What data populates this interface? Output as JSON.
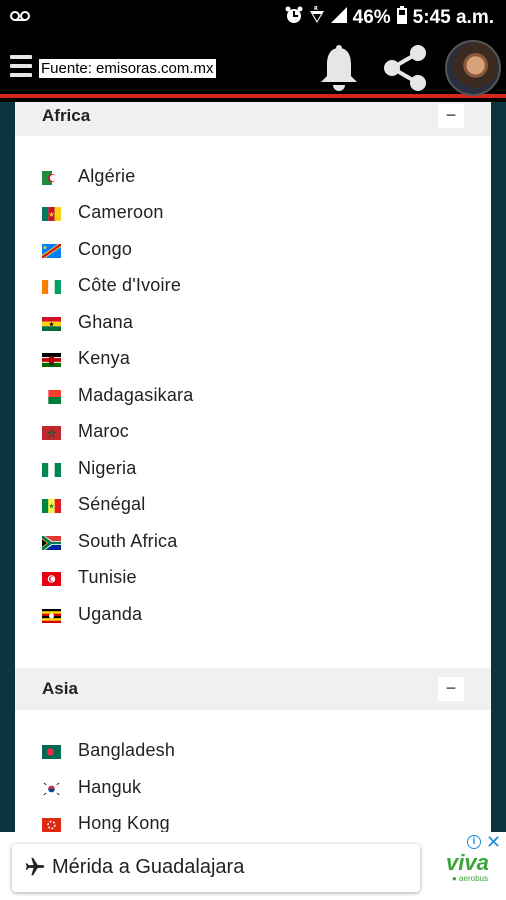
{
  "status_bar": {
    "battery": "46%",
    "time": "5:45 a.m.",
    "icons": [
      "voicemail-icon",
      "alarm-icon",
      "wifi-icon",
      "signal-icon",
      "battery-icon"
    ]
  },
  "app_bar": {
    "source_label": "Fuente: emisoras.com.mx",
    "icons": [
      "menu-icon",
      "bell-icon",
      "share-icon",
      "avatar"
    ]
  },
  "sections": [
    {
      "title": "Africa",
      "toggle": "−",
      "countries": [
        {
          "name": "Algérie",
          "flag": "algeria"
        },
        {
          "name": "Cameroon",
          "flag": "cameroon"
        },
        {
          "name": "Congo",
          "flag": "congo"
        },
        {
          "name": "Côte d'Ivoire",
          "flag": "cote-divoire"
        },
        {
          "name": "Ghana",
          "flag": "ghana"
        },
        {
          "name": "Kenya",
          "flag": "kenya"
        },
        {
          "name": "Madagasikara",
          "flag": "madagascar"
        },
        {
          "name": "Maroc",
          "flag": "morocco"
        },
        {
          "name": "Nigeria",
          "flag": "nigeria"
        },
        {
          "name": "Sénégal",
          "flag": "senegal"
        },
        {
          "name": "South Africa",
          "flag": "south-africa"
        },
        {
          "name": "Tunisie",
          "flag": "tunisia"
        },
        {
          "name": "Uganda",
          "flag": "uganda"
        }
      ]
    },
    {
      "title": "Asia",
      "toggle": "−",
      "countries": [
        {
          "name": "Bangladesh",
          "flag": "bangladesh"
        },
        {
          "name": "Hanguk",
          "flag": "south-korea"
        },
        {
          "name": "Hong Kong",
          "flag": "hong-kong"
        }
      ]
    }
  ],
  "ad": {
    "text": "Mérida a Guadalajara",
    "brand": "viva",
    "brand_sub": "● aerobus",
    "info": "i",
    "close": "✕"
  },
  "colors": {
    "accent_red": "#d7261e",
    "background_teal": "#0b3440",
    "ad_link_blue": "#1a8fd8",
    "brand_green": "#3aa43a"
  }
}
